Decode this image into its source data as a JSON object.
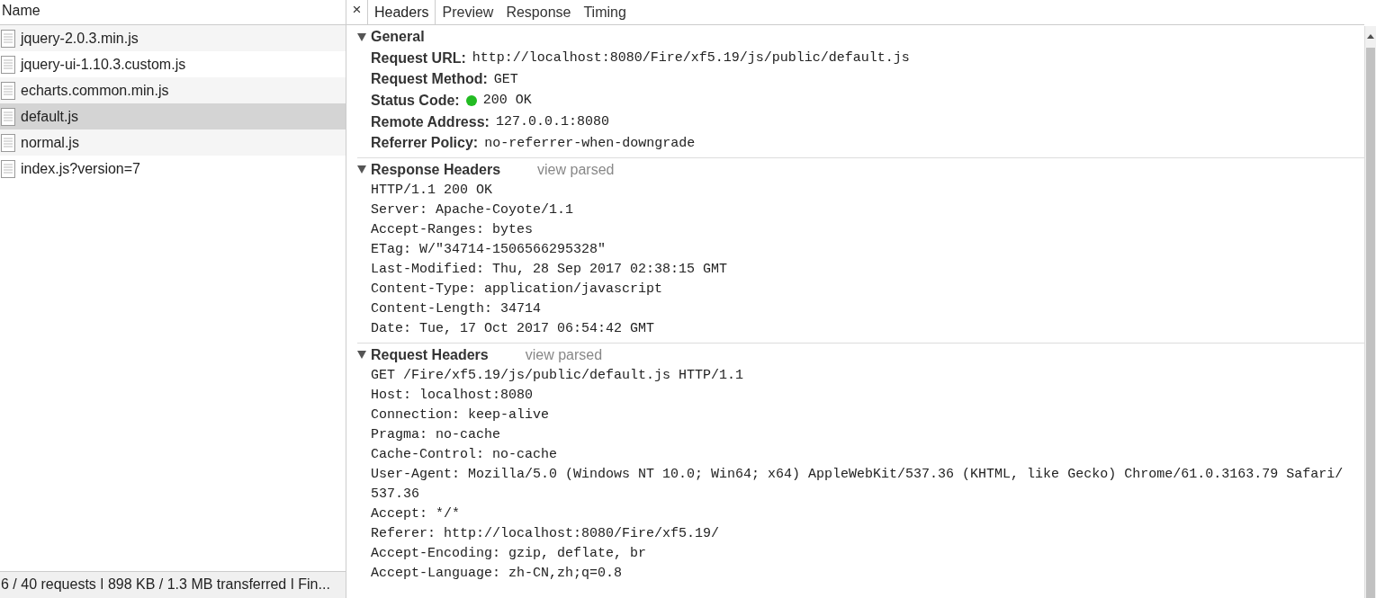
{
  "sidebar": {
    "column": "Name",
    "items": [
      {
        "name": "jquery-2.0.3.min.js",
        "selected": false
      },
      {
        "name": "jquery-ui-1.10.3.custom.js",
        "selected": false
      },
      {
        "name": "echarts.common.min.js",
        "selected": false
      },
      {
        "name": "default.js",
        "selected": true
      },
      {
        "name": "normal.js",
        "selected": false
      },
      {
        "name": "index.js?version=7",
        "selected": false
      }
    ],
    "status_bar": "6 / 40 requests ǀ 898 KB / 1.3 MB transferred ǀ Fin..."
  },
  "detail": {
    "close": "×",
    "tabs": [
      {
        "label": "Headers",
        "selected": true
      },
      {
        "label": "Preview",
        "selected": false
      },
      {
        "label": "Response",
        "selected": false
      },
      {
        "label": "Timing",
        "selected": false
      }
    ],
    "sections": [
      {
        "title": "General",
        "expanded": true,
        "kind": "pairs",
        "rows": [
          {
            "label": "Request URL:",
            "value": "http://localhost:8080/Fire/xf5.19/js/public/default.js"
          },
          {
            "label": "Request Method:",
            "value": "GET"
          },
          {
            "label": "Status Code:",
            "value": "200 OK",
            "color": "#22bb22"
          },
          {
            "label": "Remote Address:",
            "value": "127.0.0.1:8080"
          },
          {
            "label": "Referrer Policy:",
            "value": "no-referrer-when-downgrade"
          }
        ]
      },
      {
        "title": "Response Headers",
        "expanded": true,
        "link": "view parsed",
        "kind": "raw",
        "lines": [
          "HTTP/1.1 200 OK",
          "Server: Apache-Coyote/1.1",
          "Accept-Ranges: bytes",
          "ETag: W/\"34714-1506566295328\"",
          "Last-Modified: Thu, 28 Sep 2017 02:38:15 GMT",
          "Content-Type: application/javascript",
          "Content-Length: 34714",
          "Date: Tue, 17 Oct 2017 06:54:42 GMT"
        ]
      },
      {
        "title": "Request Headers",
        "expanded": true,
        "link": "view parsed",
        "kind": "raw",
        "lines": [
          "GET /Fire/xf5.19/js/public/default.js HTTP/1.1",
          "Host: localhost:8080",
          "Connection: keep-alive",
          "Pragma: no-cache",
          "Cache-Control: no-cache",
          "User-Agent: Mozilla/5.0 (Windows NT 10.0; Win64; x64) AppleWebKit/537.36 (KHTML, like Gecko) Chrome/61.0.3163.79 Safari/537.36",
          "Accept: */*",
          "Referer: http://localhost:8080/Fire/xf5.19/",
          "Accept-Encoding: gzip, deflate, br",
          "Accept-Language: zh-CN,zh;q=0.8"
        ]
      }
    ]
  }
}
